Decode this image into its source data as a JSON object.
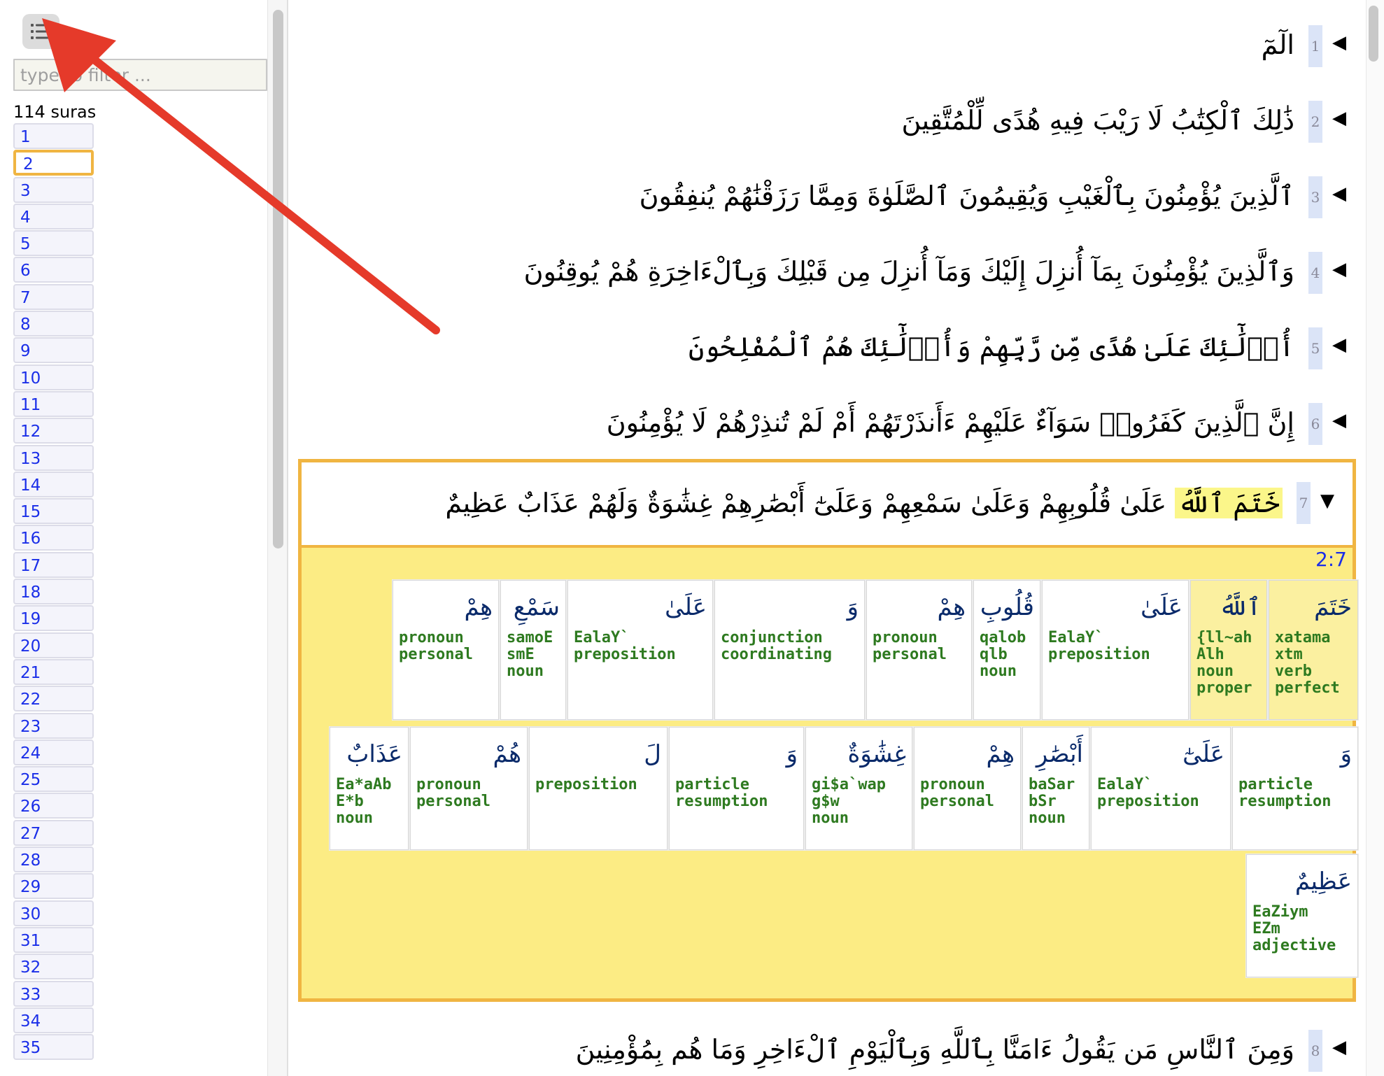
{
  "sidebar": {
    "filter_placeholder": "type to filter ...",
    "count_label": "114 suras",
    "suras": [
      "1",
      "2",
      "3",
      "4",
      "5",
      "6",
      "7",
      "8",
      "9",
      "10",
      "11",
      "12",
      "13",
      "14",
      "15",
      "16",
      "17",
      "18",
      "19",
      "20",
      "21",
      "22",
      "23",
      "24",
      "25",
      "26",
      "27",
      "28",
      "29",
      "30",
      "31",
      "32",
      "33",
      "34",
      "35"
    ],
    "active": "2"
  },
  "verses": [
    {
      "num": "1",
      "text": "الٓمٓ"
    },
    {
      "num": "2",
      "text": "ذَٰلِكَ ٱلْكِتَٰبُ لَا رَيْبَ فِيهِ هُدًى لِّلْمُتَّقِينَ"
    },
    {
      "num": "3",
      "text": "ٱلَّذِينَ يُؤْمِنُونَ بِٱلْغَيْبِ وَيُقِيمُونَ ٱلصَّلَوٰةَ وَمِمَّا رَزَقْنَٰهُمْ يُنفِقُونَ"
    },
    {
      "num": "4",
      "text": "وَٱلَّذِينَ يُؤْمِنُونَ بِمَآ أُنزِلَ إِلَيْكَ وَمَآ أُنزِلَ مِن قَبْلِكَ وَبِٱلْءَاخِرَةِ هُمْ يُوقِنُونَ"
    },
    {
      "num": "5",
      "text": "أُو۟لَٰٓئِكَ عَلَىٰ هُدًى مِّن رَّبِّهِمْ وَأُو۟لَٰٓئِكَ هُمُ ٱلْمُفْلِحُونَ"
    },
    {
      "num": "6",
      "text": "إِنَّ ٱلَّذِينَ كَفَرُوا۟ سَوَآءٌ عَلَيْهِمْ ءَأَنذَرْتَهُمْ أَمْ لَمْ تُنذِرْهُمْ لَا يُؤْمِنُونَ"
    }
  ],
  "verse7": {
    "num": "7",
    "highlight": "خَتَمَ ٱللَّهُ",
    "rest": "عَلَىٰ قُلُوبِهِمْ وَعَلَىٰ سَمْعِهِمْ وَعَلَىٰٓ أَبْصَٰرِهِمْ غِشَٰوَةٌ وَلَهُمْ عَذَابٌ عَظِيمٌ",
    "ref": "2:7",
    "words": [
      {
        "ar": "خَتَمَ",
        "info": "xatama\nxtm\nverb\nperfect",
        "hl": true
      },
      {
        "ar": "ٱللَّهُ",
        "info": "{ll~ah\nAlh\nnoun\nproper",
        "hl": true
      },
      {
        "ar": "عَلَىٰ",
        "info": "EalaY`\npreposition",
        "hl": false
      },
      {
        "ar": "قُلُوبِ",
        "info": "qalob\nqlb\nnoun",
        "hl": false
      },
      {
        "ar": "هِمْ",
        "info": "pronoun\npersonal",
        "hl": false
      },
      {
        "ar": "وَ",
        "info": "conjunction\ncoordinating",
        "hl": false
      },
      {
        "ar": "عَلَىٰ",
        "info": "EalaY`\npreposition",
        "hl": false
      },
      {
        "ar": "سَمْعِ",
        "info": "samoE\nsmE\nnoun",
        "hl": false
      },
      {
        "ar": "هِمْ",
        "info": "pronoun\npersonal",
        "hl": false
      },
      {
        "ar": "وَ",
        "info": "particle\nresumption",
        "hl": false
      },
      {
        "ar": "عَلَىٰٓ",
        "info": "EalaY`\npreposition",
        "hl": false
      },
      {
        "ar": "أَبْصَٰرِ",
        "info": "baSar\nbSr\nnoun",
        "hl": false
      },
      {
        "ar": "هِمْ",
        "info": "pronoun\npersonal",
        "hl": false
      },
      {
        "ar": "غِشَٰوَةٌ",
        "info": "gi$a`wap\ng$w\nnoun",
        "hl": false
      },
      {
        "ar": "وَ",
        "info": "particle\nresumption",
        "hl": false
      },
      {
        "ar": "لَ",
        "info": "preposition",
        "hl": false
      },
      {
        "ar": "هُمْ",
        "info": "pronoun\npersonal",
        "hl": false
      },
      {
        "ar": "عَذَابٌ",
        "info": "Ea*aAb\nE*b\nnoun",
        "hl": false
      },
      {
        "ar": "عَظِيمٌ",
        "info": "EaZiym\nEZm\nadjective",
        "hl": false
      }
    ]
  },
  "verse8": {
    "num": "8",
    "text": "وَمِنَ ٱلنَّاسِ مَن يَقُولُ ءَامَنَّا بِٱللَّهِ وَبِٱلْيَوْمِ ٱلْءَاخِرِ وَمَا هُم بِمُؤْمِنِينَ"
  },
  "icons": {
    "menu": "list-icon",
    "collapsed": "triangle-left-icon",
    "expanded": "triangle-down-icon"
  },
  "colors": {
    "accent": "#f0b542",
    "link": "#1a2ee8",
    "morph": "#2e7a20",
    "arrow": "#e53a2a"
  }
}
